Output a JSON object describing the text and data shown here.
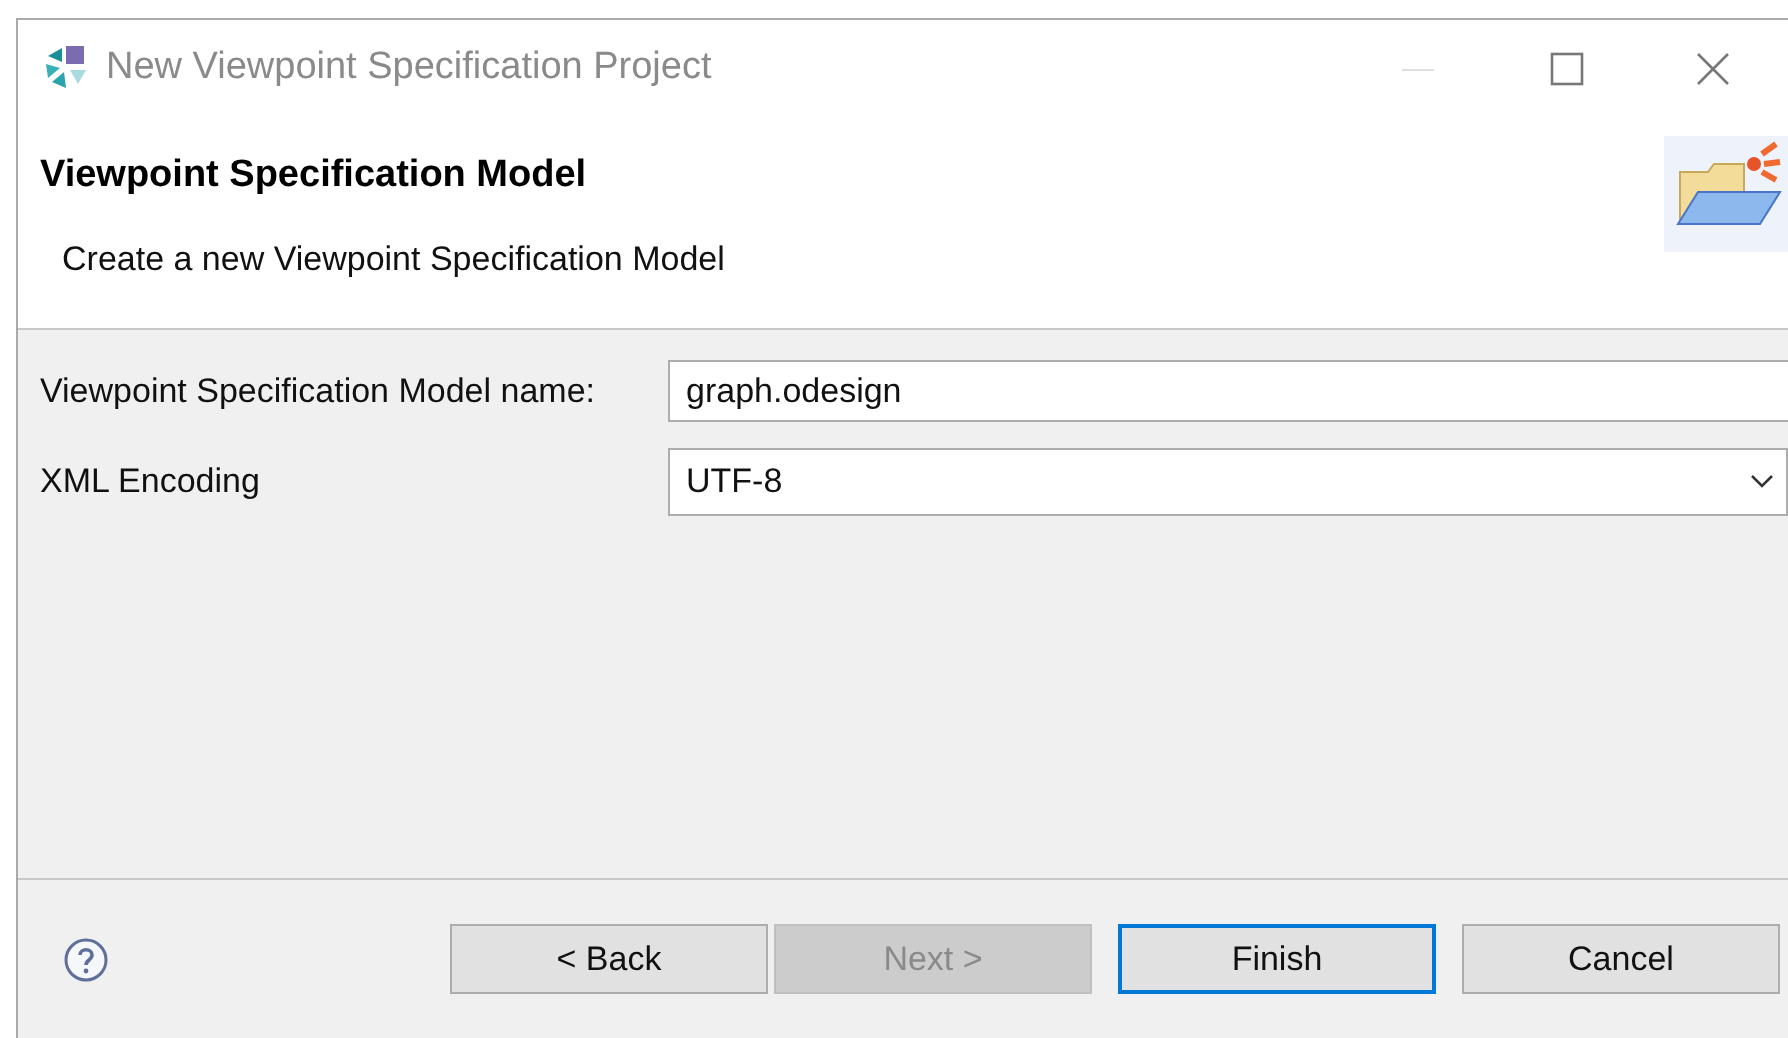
{
  "window": {
    "title": "New Viewpoint Specification Project",
    "controls": [
      {
        "kind": "minimize",
        "disabled": true
      },
      {
        "kind": "maximize",
        "disabled": false
      },
      {
        "kind": "close",
        "disabled": false
      }
    ]
  },
  "header": {
    "title": "Viewpoint Specification Model",
    "description": "Create a new Viewpoint Specification Model"
  },
  "fields": [
    {
      "kind": "text",
      "label": "Viewpoint Specification Model name:",
      "value": "graph.odesign"
    },
    {
      "kind": "combo",
      "label": "XML Encoding",
      "value": "UTF-8"
    }
  ],
  "buttons": [
    {
      "label": "< Back",
      "disabled": false,
      "default": false
    },
    {
      "label": "Next >",
      "disabled": true,
      "default": false
    },
    {
      "label": "Finish",
      "disabled": false,
      "default": true
    },
    {
      "label": "Cancel",
      "disabled": false,
      "default": false
    }
  ]
}
